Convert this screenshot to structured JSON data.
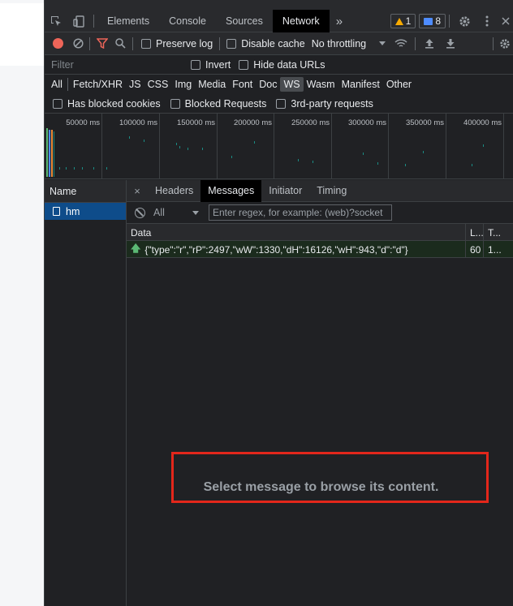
{
  "toolbar": {
    "tabs": [
      "Elements",
      "Console",
      "Sources",
      "Network"
    ],
    "more": "»",
    "warnings_count": "1",
    "messages_count": "8"
  },
  "network_toolbar": {
    "preserve_log": "Preserve log",
    "disable_cache": "Disable cache",
    "throttling": "No throttling"
  },
  "filter": {
    "placeholder": "Filter",
    "invert": "Invert",
    "hide_data_urls": "Hide data URLs"
  },
  "types": [
    "All",
    "Fetch/XHR",
    "JS",
    "CSS",
    "Img",
    "Media",
    "Font",
    "Doc",
    "WS",
    "Wasm",
    "Manifest",
    "Other"
  ],
  "options": {
    "blocked_cookies": "Has blocked cookies",
    "blocked_requests": "Blocked Requests",
    "third_party": "3rd-party requests"
  },
  "timeline": {
    "ticks": [
      "50000 ms",
      "100000 ms",
      "150000 ms",
      "200000 ms",
      "250000 ms",
      "300000 ms",
      "350000 ms",
      "400000 ms"
    ]
  },
  "requests": {
    "header": "Name",
    "items": [
      "hm"
    ]
  },
  "detail": {
    "close": "×",
    "tabs": [
      "Headers",
      "Messages",
      "Initiator",
      "Timing"
    ],
    "message_filter": "All",
    "regex_placeholder": "Enter regex, for example: (web)?socket",
    "columns": [
      "Data",
      "L...",
      "T..."
    ],
    "rows": [
      {
        "arrow": "🡅",
        "data": "{\"type\":\"r\",\"rP\":2497,\"wW\":1330,\"dH\":16126,\"wH\":943,\"d\":\"d\"}",
        "length": "60",
        "time": "1..."
      }
    ],
    "empty_text": "Select message to browse its content."
  }
}
